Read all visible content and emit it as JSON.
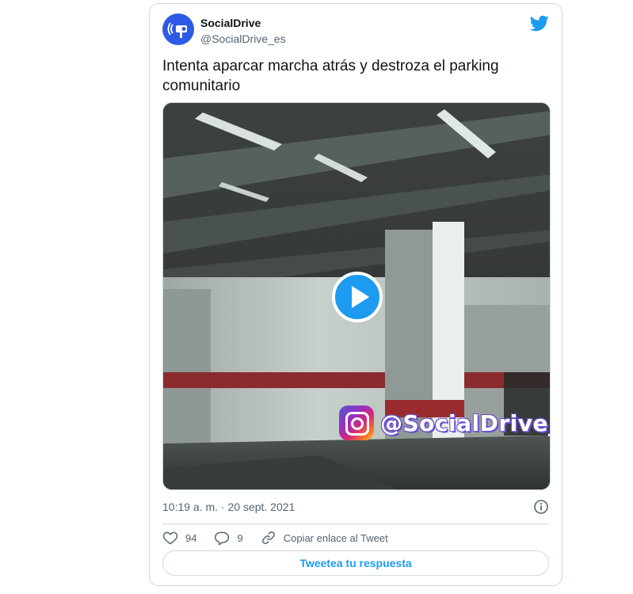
{
  "tweet": {
    "author": {
      "display_name": "SocialDrive",
      "handle": "@SocialDrive_es",
      "avatar_icon": "speed-camera-icon"
    },
    "text": "Intenta aparcar marcha atrás y destroza el parking comunitario",
    "media": {
      "type": "video",
      "play_icon": "play-icon",
      "watermark_text": "@SocialDrive_es",
      "watermark_icon": "instagram-icon"
    },
    "timestamp": "10:19 a. m. · 20 sept. 2021",
    "actions": {
      "likes": "94",
      "replies": "9",
      "copy_link_label": "Copiar enlace al Tweet"
    },
    "reply_button_label": "Tweetea tu respuesta"
  },
  "colors": {
    "twitter_blue": "#1d9bf0",
    "text_primary": "#0f1419",
    "text_secondary": "#536471",
    "border": "#cfd9de"
  }
}
